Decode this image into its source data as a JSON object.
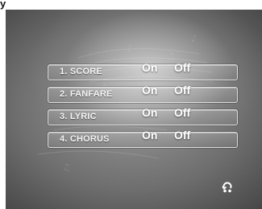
{
  "top_glyph": "y",
  "menu": {
    "items": [
      {
        "label": "1. SCORE",
        "on": "On",
        "off": "Off"
      },
      {
        "label": "2. FANFARE",
        "on": "On",
        "off": "Off"
      },
      {
        "label": "3. LYRIC",
        "on": "On",
        "off": "Off"
      },
      {
        "label": "4. CHORUS",
        "on": "On",
        "off": "Off"
      }
    ]
  },
  "icons": {
    "return": "return-icon"
  },
  "colors": {
    "text": "#ffffff",
    "row_border": "#ebebeb",
    "background_dark": "#3e3e3e",
    "background_light": "#9a9a9a"
  }
}
